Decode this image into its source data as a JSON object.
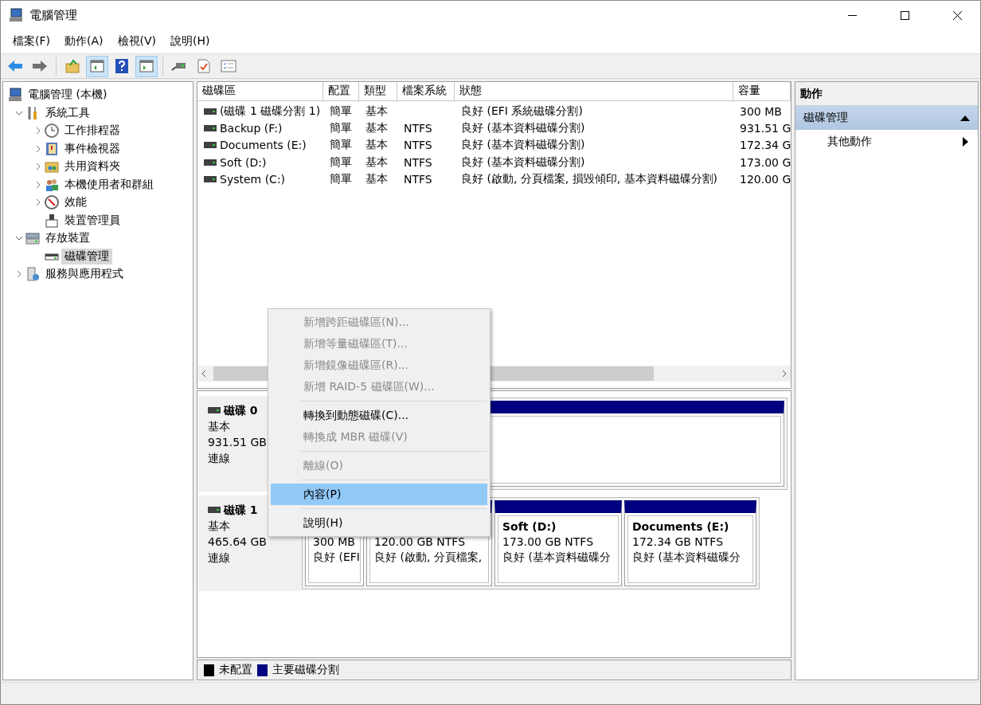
{
  "window": {
    "title": "電腦管理"
  },
  "menu_bar": [
    "檔案(F)",
    "動作(A)",
    "檢視(V)",
    "說明(H)"
  ],
  "toolbar": [
    {
      "kind": "back",
      "pressed": false
    },
    {
      "kind": "forward",
      "pressed": false
    },
    {
      "kind": "up",
      "pressed": false
    },
    {
      "kind": "tree",
      "pressed": true
    },
    {
      "kind": "help",
      "pressed": false
    },
    {
      "kind": "pane",
      "pressed": true
    },
    {
      "kind": "connect",
      "pressed": false
    },
    {
      "kind": "check",
      "pressed": false
    },
    {
      "kind": "list",
      "pressed": false
    }
  ],
  "tree": [
    {
      "label": "電腦管理 (本機)",
      "kind": "computer",
      "selected": false,
      "children": [
        {
          "label": "系統工具",
          "kind": "tools",
          "selected": false,
          "expanded": true,
          "children": [
            {
              "label": "工作排程器",
              "kind": "clock",
              "selected": false,
              "expanded": false
            },
            {
              "label": "事件檢視器",
              "kind": "log",
              "selected": false,
              "expanded": false
            },
            {
              "label": "共用資料夾",
              "kind": "folder",
              "selected": false,
              "expanded": false
            },
            {
              "label": "本機使用者和群組",
              "kind": "users",
              "selected": false,
              "expanded": false
            },
            {
              "label": "效能",
              "kind": "gauge",
              "selected": false,
              "expanded": false
            },
            {
              "label": "裝置管理員",
              "kind": "device",
              "selected": false
            }
          ]
        },
        {
          "label": "存放裝置",
          "kind": "storage",
          "selected": false,
          "expanded": true,
          "children": [
            {
              "label": "磁碟管理",
              "kind": "disk",
              "selected": true
            }
          ]
        },
        {
          "label": "服務與應用程式",
          "kind": "services",
          "selected": false,
          "expanded": false
        }
      ]
    }
  ],
  "volume_table": {
    "columns": [
      "磁碟區",
      "配置",
      "類型",
      "檔案系統",
      "狀態",
      "容量"
    ],
    "rows": [
      {
        "volume": "(磁碟 1 磁碟分割 1)",
        "layout": "簡單",
        "type": "基本",
        "status": "良好 (EFI 系統磁碟分割)",
        "capacity": "300 MB"
      },
      {
        "volume": "Backup (F:)",
        "layout": "簡單",
        "type": "基本",
        "file_system": "NTFS",
        "status": "良好 (基本資料磁碟分割)",
        "capacity": "931.51 G"
      },
      {
        "volume": "Documents (E:)",
        "layout": "簡單",
        "type": "基本",
        "file_system": "NTFS",
        "status": "良好 (基本資料磁碟分割)",
        "capacity": "172.34 G"
      },
      {
        "volume": "Soft (D:)",
        "layout": "簡單",
        "type": "基本",
        "file_system": "NTFS",
        "status": "良好 (基本資料磁碟分割)",
        "capacity": "173.00 G"
      },
      {
        "volume": "System (C:)",
        "layout": "簡單",
        "type": "基本",
        "file_system": "NTFS",
        "status": "良好 (啟動, 分頁檔案, 損毀傾印, 基本資料磁碟分割)",
        "capacity": "120.00 G"
      }
    ]
  },
  "disks": [
    {
      "name": "磁碟 0",
      "type": "基本",
      "size": "931.51 GB",
      "status": "連線",
      "partitions": [
        {
          "kind": "primary"
        }
      ]
    },
    {
      "name": "磁碟 1",
      "type": "基本",
      "size": "465.64 GB",
      "status": "連線",
      "partitions": [
        {
          "kind": "primary",
          "lines": [
            "300 MB",
            "良好 (EFI"
          ]
        },
        {
          "kind": "primary",
          "lines": [
            "120.00 GB NTFS",
            "良好 (啟動, 分頁檔案,"
          ]
        },
        {
          "kind": "primary",
          "title": "Soft  (D:)",
          "lines": [
            "173.00 GB NTFS",
            "良好 (基本資料磁碟分"
          ]
        },
        {
          "kind": "primary",
          "title": "Documents  (E:)",
          "lines": [
            "172.34 GB NTFS",
            "良好 (基本資料磁碟分"
          ]
        }
      ]
    }
  ],
  "legend": [
    {
      "label": "未配置",
      "color": "#000000"
    },
    {
      "label": "主要磁碟分割",
      "color": "#000080"
    }
  ],
  "actions": {
    "title": "動作",
    "section": {
      "label": "磁碟管理",
      "expanded": true
    },
    "items": [
      {
        "label": "其他動作"
      }
    ]
  },
  "context_menu": [
    {
      "label": "新增跨距磁碟區(N)...",
      "disabled": true,
      "selected": false,
      "separator_before": false
    },
    {
      "label": "新增等量磁碟區(T)...",
      "disabled": true,
      "selected": false,
      "separator_before": false
    },
    {
      "label": "新增鏡像磁碟區(R)...",
      "disabled": true,
      "selected": false,
      "separator_before": false
    },
    {
      "label": "新增 RAID-5 磁碟區(W)...",
      "disabled": true,
      "selected": false,
      "separator_before": false
    },
    {
      "label": "轉換到動態磁碟(C)...",
      "disabled": false,
      "selected": false,
      "separator_before": true
    },
    {
      "label": "轉換成 MBR 磁碟(V)",
      "disabled": true,
      "selected": false,
      "separator_before": false
    },
    {
      "label": "離線(O)",
      "disabled": true,
      "selected": false,
      "separator_before": true
    },
    {
      "label": "內容(P)",
      "disabled": false,
      "selected": true,
      "separator_before": true
    },
    {
      "label": "說明(H)",
      "disabled": false,
      "selected": false,
      "separator_before": true
    }
  ]
}
